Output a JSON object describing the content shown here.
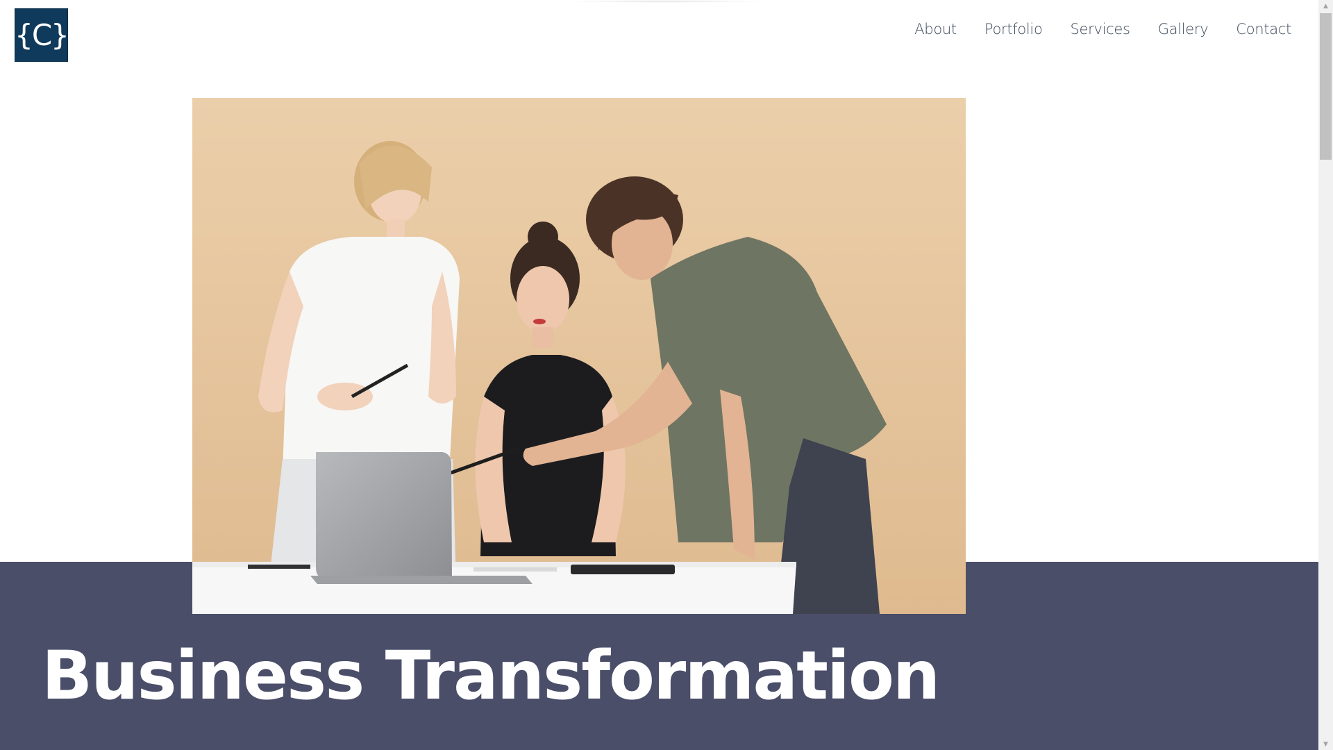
{
  "logo": {
    "text": "{C}"
  },
  "nav": {
    "items": [
      {
        "label": "About"
      },
      {
        "label": "Portfolio"
      },
      {
        "label": "Services"
      },
      {
        "label": "Gallery"
      },
      {
        "label": "Contact"
      }
    ]
  },
  "hero": {
    "title": "Business Transformation",
    "image_description_icon": "team-photo"
  },
  "colors": {
    "brand": "#0f3a5b",
    "band": "#4a4e69",
    "nav_text": "#3c4a5c"
  },
  "scrollbar": {
    "up_icon": "▲",
    "down_icon": "▼"
  }
}
